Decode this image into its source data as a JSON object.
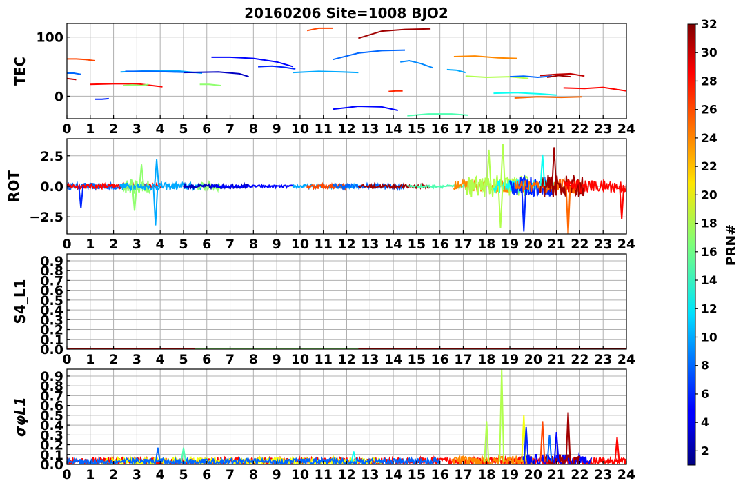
{
  "figure": {
    "title": "20160206 Site=1008 BJO2"
  },
  "chart_data": [
    {
      "type": "line",
      "panel": "tec",
      "ylabel": "TEC",
      "xlim": [
        0,
        24
      ],
      "ylim": [
        -38,
        123
      ],
      "x_ticks": [
        "0",
        "1",
        "2",
        "3",
        "4",
        "5",
        "6",
        "7",
        "8",
        "9",
        "10",
        "11",
        "12",
        "13",
        "14",
        "15",
        "16",
        "17",
        "18",
        "19",
        "20",
        "21",
        "22",
        "23",
        "24"
      ],
      "y_ticks": [
        {
          "v": 0,
          "label": "0"
        },
        {
          "v": 100,
          "label": "100"
        }
      ],
      "grid": true,
      "series": [
        {
          "prn": 26,
          "x": [
            0.0,
            0.4,
            0.8,
            1.2
          ],
          "y": [
            63,
            63,
            62,
            60
          ]
        },
        {
          "prn": 30,
          "x": [
            0.0,
            0.4
          ],
          "y": [
            30,
            28
          ]
        },
        {
          "prn": 8,
          "x": [
            0.0,
            0.3,
            0.6
          ],
          "y": [
            39,
            39,
            37
          ]
        },
        {
          "prn": 6,
          "x": [
            1.2,
            1.5,
            1.8
          ],
          "y": [
            -5,
            -5,
            -4
          ]
        },
        {
          "prn": 28,
          "x": [
            1.0,
            2.0,
            3.0,
            4.1
          ],
          "y": [
            20,
            21,
            21,
            16
          ]
        },
        {
          "prn": 17,
          "x": [
            2.4,
            2.8,
            3.2,
            3.5
          ],
          "y": [
            18,
            19,
            18,
            20
          ]
        },
        {
          "prn": 10,
          "x": [
            2.3,
            3.5,
            4.7,
            5.8
          ],
          "y": [
            41,
            43,
            43,
            39
          ]
        },
        {
          "prn": 8,
          "x": [
            2.5,
            3.5,
            4.5,
            5.5
          ],
          "y": [
            42,
            42,
            41,
            40
          ]
        },
        {
          "prn": 17,
          "x": [
            5.7,
            6.1,
            6.6
          ],
          "y": [
            20,
            20,
            18
          ]
        },
        {
          "prn": 3,
          "x": [
            5.0,
            6.5,
            7.4,
            7.8
          ],
          "y": [
            40,
            41,
            38,
            33
          ]
        },
        {
          "prn": 5,
          "x": [
            6.2,
            7.0,
            8.0,
            9.0,
            9.7
          ],
          "y": [
            66,
            66,
            64,
            58,
            50
          ]
        },
        {
          "prn": 6,
          "x": [
            8.2,
            8.8,
            9.3,
            9.8
          ],
          "y": [
            50,
            51,
            49,
            46
          ]
        },
        {
          "prn": 10,
          "x": [
            9.7,
            10.8,
            11.8,
            12.5
          ],
          "y": [
            40,
            42,
            41,
            40
          ]
        },
        {
          "prn": 26,
          "x": [
            10.3,
            10.8,
            11.4
          ],
          "y": [
            111,
            115,
            115
          ]
        },
        {
          "prn": 31,
          "x": [
            12.5,
            13.5,
            14.5,
            15.6
          ],
          "y": [
            98,
            110,
            113,
            114
          ]
        },
        {
          "prn": 8,
          "x": [
            11.4,
            12.5,
            13.5,
            14.5
          ],
          "y": [
            62,
            73,
            77,
            78
          ]
        },
        {
          "prn": 9,
          "x": [
            14.3,
            14.7,
            15.2,
            15.7
          ],
          "y": [
            58,
            60,
            55,
            48
          ]
        },
        {
          "prn": 5,
          "x": [
            11.4,
            12.5,
            13.5,
            14.2
          ],
          "y": [
            -22,
            -17,
            -18,
            -24
          ]
        },
        {
          "prn": 27,
          "x": [
            13.8,
            14.1,
            14.4
          ],
          "y": [
            8,
            9,
            9
          ]
        },
        {
          "prn": 15,
          "x": [
            14.6,
            15.5,
            16.5,
            17.2
          ],
          "y": [
            -33,
            -30,
            -30,
            -32
          ]
        },
        {
          "prn": 10,
          "x": [
            16.3,
            16.7,
            17.1
          ],
          "y": [
            45,
            44,
            40
          ]
        },
        {
          "prn": 24,
          "x": [
            16.6,
            17.5,
            18.5,
            19.3
          ],
          "y": [
            67,
            68,
            65,
            64
          ]
        },
        {
          "prn": 18,
          "x": [
            17.1,
            18.0,
            19.0,
            19.8
          ],
          "y": [
            34,
            32,
            33,
            30
          ]
        },
        {
          "prn": 13,
          "x": [
            18.3,
            19.3,
            20.3,
            21.0
          ],
          "y": [
            5,
            6,
            4,
            2
          ]
        },
        {
          "prn": 25,
          "x": [
            19.2,
            20.2,
            21.2,
            22.1
          ],
          "y": [
            -3,
            -1,
            -2,
            -1
          ]
        },
        {
          "prn": 8,
          "x": [
            19.0,
            19.6,
            20.2,
            20.8
          ],
          "y": [
            33,
            34,
            32,
            34
          ]
        },
        {
          "prn": 30,
          "x": [
            20.3,
            21.0,
            21.6,
            22.2
          ],
          "y": [
            35,
            37,
            38,
            34
          ]
        },
        {
          "prn": 31,
          "x": [
            20.6,
            21.1,
            21.6
          ],
          "y": [
            32,
            35,
            33
          ]
        },
        {
          "prn": 28,
          "x": [
            21.3,
            22.2,
            23.0,
            24.0
          ],
          "y": [
            14,
            13,
            15,
            9
          ]
        }
      ]
    },
    {
      "type": "line",
      "panel": "rot",
      "ylabel": "ROT",
      "xlim": [
        0,
        24
      ],
      "ylim": [
        -3.9,
        3.9
      ],
      "x_ticks": [
        "0",
        "1",
        "2",
        "3",
        "4",
        "5",
        "6",
        "7",
        "8",
        "9",
        "10",
        "11",
        "12",
        "13",
        "14",
        "15",
        "16",
        "17",
        "18",
        "19",
        "20",
        "21",
        "22",
        "23",
        "24"
      ],
      "y_ticks": [
        {
          "v": 2.5,
          "label": "2.5"
        },
        {
          "v": 0,
          "label": "0.0"
        },
        {
          "v": -2.5,
          "label": "−2.5"
        }
      ],
      "grid": true,
      "noise_series": [
        {
          "prn": 8,
          "x0": 0.0,
          "x1": 2.5,
          "amp": 0.25
        },
        {
          "prn": 28,
          "x0": 0.0,
          "x1": 4.0,
          "amp": 0.2
        },
        {
          "prn": 17,
          "x0": 2.4,
          "x1": 3.6,
          "amp": 0.6
        },
        {
          "prn": 10,
          "x0": 2.3,
          "x1": 5.8,
          "amp": 0.3
        },
        {
          "prn": 17,
          "x0": 5.6,
          "x1": 6.6,
          "amp": 0.35
        },
        {
          "prn": 3,
          "x0": 5.0,
          "x1": 7.8,
          "amp": 0.15
        },
        {
          "prn": 5,
          "x0": 6.2,
          "x1": 9.7,
          "amp": 0.1
        },
        {
          "prn": 10,
          "x0": 9.7,
          "x1": 12.5,
          "amp": 0.15
        },
        {
          "prn": 26,
          "x0": 10.3,
          "x1": 12.0,
          "amp": 0.2
        },
        {
          "prn": 8,
          "x0": 11.4,
          "x1": 14.5,
          "amp": 0.2
        },
        {
          "prn": 31,
          "x0": 12.5,
          "x1": 15.6,
          "amp": 0.15
        },
        {
          "prn": 15,
          "x0": 14.6,
          "x1": 17.2,
          "amp": 0.1
        },
        {
          "prn": 24,
          "x0": 16.6,
          "x1": 19.3,
          "amp": 0.5
        },
        {
          "prn": 18,
          "x0": 17.1,
          "x1": 19.8,
          "amp": 0.9
        },
        {
          "prn": 13,
          "x0": 18.3,
          "x1": 21.0,
          "amp": 0.55
        },
        {
          "prn": 6,
          "x0": 19.0,
          "x1": 20.8,
          "amp": 0.8
        },
        {
          "prn": 25,
          "x0": 19.2,
          "x1": 22.1,
          "amp": 0.6
        },
        {
          "prn": 31,
          "x0": 20.3,
          "x1": 22.2,
          "amp": 0.9
        },
        {
          "prn": 28,
          "x0": 21.3,
          "x1": 24.0,
          "amp": 0.5
        }
      ],
      "spikes": [
        {
          "prn": 6,
          "x": 0.6,
          "y": -1.8
        },
        {
          "prn": 17,
          "x": 2.9,
          "y": -2.0
        },
        {
          "prn": 17,
          "x": 3.2,
          "y": 1.8
        },
        {
          "prn": 10,
          "x": 3.8,
          "y": -3.2
        },
        {
          "prn": 10,
          "x": 3.85,
          "y": 2.2
        },
        {
          "prn": 18,
          "x": 18.1,
          "y": 3.0
        },
        {
          "prn": 18,
          "x": 18.6,
          "y": -3.4
        },
        {
          "prn": 18,
          "x": 18.7,
          "y": 3.5
        },
        {
          "prn": 6,
          "x": 19.6,
          "y": -3.7
        },
        {
          "prn": 13,
          "x": 20.4,
          "y": 2.6
        },
        {
          "prn": 31,
          "x": 20.9,
          "y": 3.2
        },
        {
          "prn": 25,
          "x": 21.5,
          "y": -3.9
        },
        {
          "prn": 28,
          "x": 23.8,
          "y": -2.7
        }
      ]
    },
    {
      "type": "line",
      "panel": "s4",
      "ylabel": "S4_L1",
      "xlim": [
        0,
        24
      ],
      "ylim": [
        0,
        0.97
      ],
      "x_ticks": [
        "0",
        "1",
        "2",
        "3",
        "4",
        "5",
        "6",
        "7",
        "8",
        "9",
        "10",
        "11",
        "12",
        "13",
        "14",
        "15",
        "16",
        "17",
        "18",
        "19",
        "20",
        "21",
        "22",
        "23",
        "24"
      ],
      "y_ticks": [
        {
          "v": 0,
          "label": "0.0"
        },
        {
          "v": 0.1,
          "label": "0.1"
        },
        {
          "v": 0.2,
          "label": "0.2"
        },
        {
          "v": 0.3,
          "label": "0.3"
        },
        {
          "v": 0.4,
          "label": "0.4"
        },
        {
          "v": 0.5,
          "label": "0.5"
        },
        {
          "v": 0.6,
          "label": "0.6"
        },
        {
          "v": 0.7,
          "label": "0.7"
        },
        {
          "v": 0.8,
          "label": "0.8"
        },
        {
          "v": 0.9,
          "label": "0.9"
        }
      ],
      "grid": true,
      "noise_series": [
        {
          "prn": 28,
          "x0": 0.0,
          "x1": 24.0,
          "amp": 0.003
        },
        {
          "prn": 17,
          "x0": 5.5,
          "x1": 12.5,
          "amp": 0.004
        },
        {
          "prn": 31,
          "x0": 19.0,
          "x1": 24.0,
          "amp": 0.003
        }
      ]
    },
    {
      "type": "line",
      "panel": "sigma",
      "ylabel": "σφL1",
      "xlim": [
        0,
        24
      ],
      "ylim": [
        0,
        0.97
      ],
      "x_ticks": [
        "0",
        "1",
        "2",
        "3",
        "4",
        "5",
        "6",
        "7",
        "8",
        "9",
        "10",
        "11",
        "12",
        "13",
        "14",
        "15",
        "16",
        "17",
        "18",
        "19",
        "20",
        "21",
        "22",
        "23",
        "24"
      ],
      "y_ticks": [
        {
          "v": 0,
          "label": "0.0"
        },
        {
          "v": 0.1,
          "label": "0.1"
        },
        {
          "v": 0.2,
          "label": "0.2"
        },
        {
          "v": 0.3,
          "label": "0.3"
        },
        {
          "v": 0.4,
          "label": "0.4"
        },
        {
          "v": 0.5,
          "label": "0.5"
        },
        {
          "v": 0.6,
          "label": "0.6"
        },
        {
          "v": 0.7,
          "label": "0.7"
        },
        {
          "v": 0.8,
          "label": "0.8"
        },
        {
          "v": 0.9,
          "label": "0.9"
        }
      ],
      "grid": true,
      "noise_series": [
        {
          "prn": 28,
          "x0": 0.0,
          "x1": 24.0,
          "amp": 0.04,
          "base": 0.03
        },
        {
          "prn": 20,
          "x0": 1.5,
          "x1": 13.5,
          "amp": 0.04,
          "base": 0.03
        },
        {
          "prn": 8,
          "x0": 0.0,
          "x1": 16.0,
          "amp": 0.03,
          "base": 0.03
        },
        {
          "prn": 24,
          "x0": 16.5,
          "x1": 20.0,
          "amp": 0.05,
          "base": 0.04
        },
        {
          "prn": 5,
          "x0": 19.5,
          "x1": 22.5,
          "amp": 0.06,
          "base": 0.04
        },
        {
          "prn": 31,
          "x0": 20.5,
          "x1": 22.0,
          "amp": 0.06,
          "base": 0.04
        }
      ],
      "spikes": [
        {
          "prn": 8,
          "x": 3.9,
          "y": 0.17
        },
        {
          "prn": 15,
          "x": 5.0,
          "y": 0.17
        },
        {
          "prn": 13,
          "x": 12.3,
          "y": 0.13
        },
        {
          "prn": 18,
          "x": 18.0,
          "y": 0.44
        },
        {
          "prn": 18,
          "x": 18.65,
          "y": 0.97
        },
        {
          "prn": 20,
          "x": 19.6,
          "y": 0.5
        },
        {
          "prn": 6,
          "x": 19.7,
          "y": 0.38
        },
        {
          "prn": 26,
          "x": 20.4,
          "y": 0.44
        },
        {
          "prn": 8,
          "x": 20.7,
          "y": 0.3
        },
        {
          "prn": 5,
          "x": 21.0,
          "y": 0.33
        },
        {
          "prn": 31,
          "x": 21.5,
          "y": 0.53
        },
        {
          "prn": 28,
          "x": 23.6,
          "y": 0.28
        }
      ]
    }
  ],
  "colorbar": {
    "label": "PRN#",
    "range": [
      1,
      32
    ],
    "ticks": [
      "2",
      "4",
      "6",
      "8",
      "10",
      "12",
      "14",
      "16",
      "18",
      "20",
      "22",
      "24",
      "26",
      "28",
      "30",
      "32"
    ]
  }
}
